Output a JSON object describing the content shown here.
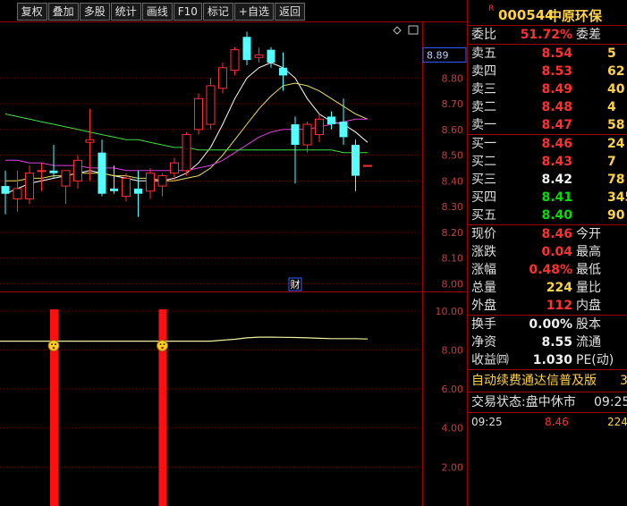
{
  "toolbar": {
    "items": [
      "复权",
      "叠加",
      "多股",
      "统计",
      "画线",
      "F10",
      "标记",
      "+自选",
      "返回"
    ]
  },
  "chart_data": {
    "type": "candlestick",
    "price_axis": {
      "ticks": [
        "8.89",
        "8.80",
        "8.70",
        "8.60",
        "8.50",
        "8.40",
        "8.30",
        "8.20",
        "8.10",
        "8.00"
      ],
      "ylim": [
        7.97,
        9.02
      ],
      "current_price_label": "8.89"
    },
    "indicator_axis": {
      "ticks": [
        "10.00",
        "8.00",
        "6.00",
        "4.00",
        "2.00"
      ],
      "ylim": [
        0,
        11
      ]
    },
    "finance_marker": "财",
    "candles": [
      {
        "o": 8.38,
        "h": 8.44,
        "l": 8.27,
        "c": 8.35
      },
      {
        "o": 8.33,
        "h": 8.44,
        "l": 8.28,
        "c": 8.37
      },
      {
        "o": 8.33,
        "h": 8.46,
        "l": 8.31,
        "c": 8.43
      },
      {
        "o": 8.44,
        "h": 8.47,
        "l": 8.36,
        "c": 8.44
      },
      {
        "o": 8.44,
        "h": 8.54,
        "l": 8.41,
        "c": 8.43
      },
      {
        "o": 8.38,
        "h": 8.44,
        "l": 8.31,
        "c": 8.44
      },
      {
        "o": 8.4,
        "h": 8.5,
        "l": 8.37,
        "c": 8.48
      },
      {
        "o": 8.55,
        "h": 8.68,
        "l": 8.4,
        "c": 8.56
      },
      {
        "o": 8.51,
        "h": 8.56,
        "l": 8.34,
        "c": 8.35
      },
      {
        "o": 8.37,
        "h": 8.46,
        "l": 8.35,
        "c": 8.36
      },
      {
        "o": 8.34,
        "h": 8.43,
        "l": 8.32,
        "c": 8.41
      },
      {
        "o": 8.37,
        "h": 8.44,
        "l": 8.26,
        "c": 8.35
      },
      {
        "o": 8.36,
        "h": 8.45,
        "l": 8.33,
        "c": 8.43
      },
      {
        "o": 8.38,
        "h": 8.43,
        "l": 8.34,
        "c": 8.42
      },
      {
        "o": 8.43,
        "h": 8.49,
        "l": 8.4,
        "c": 8.47
      },
      {
        "o": 8.44,
        "h": 8.59,
        "l": 8.42,
        "c": 8.58
      },
      {
        "o": 8.6,
        "h": 8.74,
        "l": 8.58,
        "c": 8.72
      },
      {
        "o": 8.62,
        "h": 8.8,
        "l": 8.6,
        "c": 8.77
      },
      {
        "o": 8.76,
        "h": 8.86,
        "l": 8.74,
        "c": 8.84
      },
      {
        "o": 8.83,
        "h": 8.92,
        "l": 8.81,
        "c": 8.91
      },
      {
        "o": 8.96,
        "h": 8.98,
        "l": 8.85,
        "c": 8.87
      },
      {
        "o": 8.88,
        "h": 8.92,
        "l": 8.86,
        "c": 8.89
      },
      {
        "o": 8.91,
        "h": 8.92,
        "l": 8.84,
        "c": 8.86
      },
      {
        "o": 8.84,
        "h": 8.9,
        "l": 8.75,
        "c": 8.81
      },
      {
        "o": 8.62,
        "h": 8.65,
        "l": 8.39,
        "c": 8.54
      },
      {
        "o": 8.54,
        "h": 8.63,
        "l": 8.51,
        "c": 8.62
      },
      {
        "o": 8.58,
        "h": 8.66,
        "l": 8.55,
        "c": 8.64
      },
      {
        "o": 8.65,
        "h": 8.67,
        "l": 8.6,
        "c": 8.62
      },
      {
        "o": 8.63,
        "h": 8.72,
        "l": 8.54,
        "c": 8.57
      },
      {
        "o": 8.54,
        "h": 8.56,
        "l": 8.36,
        "c": 8.42
      },
      {
        "o": 8.46,
        "h": 8.46,
        "l": 8.46,
        "c": 8.46
      }
    ],
    "series": [
      {
        "color": "#ffffff",
        "values": [
          8.35,
          8.37,
          8.39,
          8.4,
          8.41,
          8.42,
          8.43,
          8.44,
          8.43,
          8.42,
          8.41,
          8.4,
          8.4,
          8.4,
          8.41,
          8.43,
          8.47,
          8.53,
          8.62,
          8.72,
          8.8,
          8.84,
          8.86,
          8.84,
          8.8,
          8.72,
          8.66,
          8.63,
          8.62,
          8.59,
          8.55
        ]
      },
      {
        "color": "#e8e060",
        "values": [
          8.4,
          8.4,
          8.41,
          8.41,
          8.42,
          8.42,
          8.43,
          8.43,
          8.43,
          8.42,
          8.42,
          8.41,
          8.41,
          8.4,
          8.4,
          8.41,
          8.42,
          8.45,
          8.5,
          8.56,
          8.62,
          8.68,
          8.73,
          8.77,
          8.78,
          8.77,
          8.75,
          8.72,
          8.69,
          8.66,
          8.64
        ]
      },
      {
        "color": "#e040e0",
        "values": [
          8.48,
          8.48,
          8.47,
          8.47,
          8.46,
          8.46,
          8.46,
          8.45,
          8.45,
          8.45,
          8.44,
          8.44,
          8.44,
          8.44,
          8.44,
          8.44,
          8.45,
          8.46,
          8.48,
          8.51,
          8.54,
          8.57,
          8.59,
          8.6,
          8.6,
          8.6,
          8.61,
          8.62,
          8.63,
          8.64,
          8.64
        ]
      },
      {
        "color": "#40e040",
        "values": [
          8.66,
          8.65,
          8.64,
          8.63,
          8.62,
          8.61,
          8.6,
          8.59,
          8.58,
          8.57,
          8.56,
          8.56,
          8.55,
          8.54,
          8.53,
          8.53,
          8.52,
          8.52,
          8.52,
          8.52,
          8.52,
          8.52,
          8.52,
          8.52,
          8.52,
          8.52,
          8.52,
          8.52,
          8.51,
          8.51,
          8.51
        ]
      }
    ],
    "indicator_line": {
      "color": "#f0f0a0",
      "values": [
        8.45,
        8.45,
        8.45,
        8.45,
        8.45,
        8.45,
        8.45,
        8.45,
        8.45,
        8.45,
        8.45,
        8.45,
        8.45,
        8.45,
        8.45,
        8.45,
        8.45,
        8.45,
        8.5,
        8.55,
        8.62,
        8.66,
        8.66,
        8.65,
        8.64,
        8.62,
        8.6,
        8.58,
        8.58,
        8.58,
        8.56
      ]
    },
    "signal_bars": [
      4,
      13
    ],
    "signal_icon": "smiley-face-icon"
  },
  "quote": {
    "badge": "R",
    "code": "000544",
    "name": "中原环保",
    "weibi": {
      "label": "委比",
      "value": "51.72%",
      "label2": "委差",
      "value2": ""
    },
    "asks": [
      {
        "label": "卖五",
        "price": "8.54",
        "vol": "5"
      },
      {
        "label": "卖四",
        "price": "8.53",
        "vol": "62"
      },
      {
        "label": "卖三",
        "price": "8.49",
        "vol": "40"
      },
      {
        "label": "卖二",
        "price": "8.48",
        "vol": "4"
      },
      {
        "label": "卖一",
        "price": "8.47",
        "vol": "58"
      }
    ],
    "bids": [
      {
        "label": "买一",
        "price": "8.46",
        "vol": "24",
        "color": "red"
      },
      {
        "label": "买二",
        "price": "8.43",
        "vol": "7",
        "color": "red"
      },
      {
        "label": "买三",
        "price": "8.42",
        "vol": "78",
        "color": "white"
      },
      {
        "label": "买四",
        "price": "8.41",
        "vol": "345",
        "color": "green"
      },
      {
        "label": "买五",
        "price": "8.40",
        "vol": "90",
        "color": "green"
      }
    ],
    "stats": [
      {
        "label": "现价",
        "value": "8.46",
        "color": "red",
        "label2": "今开"
      },
      {
        "label": "涨跌",
        "value": "0.04",
        "color": "red",
        "label2": "最高"
      },
      {
        "label": "涨幅",
        "value": "0.48%",
        "color": "red",
        "label2": "最低"
      },
      {
        "label": "总量",
        "value": "224",
        "color": "yellow",
        "label2": "量比"
      },
      {
        "label": "外盘",
        "value": "112",
        "color": "red",
        "label2": "内盘"
      }
    ],
    "finance": [
      {
        "label": "换手",
        "value": "0.00%",
        "label2": "股本"
      },
      {
        "label": "净资",
        "value": "8.55",
        "label2": "流通"
      },
      {
        "label": "收益㈣",
        "value": "1.030",
        "label2": "PE(动)"
      }
    ],
    "ad_text": "自动续费通达信普及版",
    "ad_num": "3",
    "status_label": "交易状态:",
    "status_value": "盘中休市",
    "status_time": "09:25",
    "tick": {
      "time": "09:25",
      "price": "8.46",
      "vol": "224"
    }
  }
}
